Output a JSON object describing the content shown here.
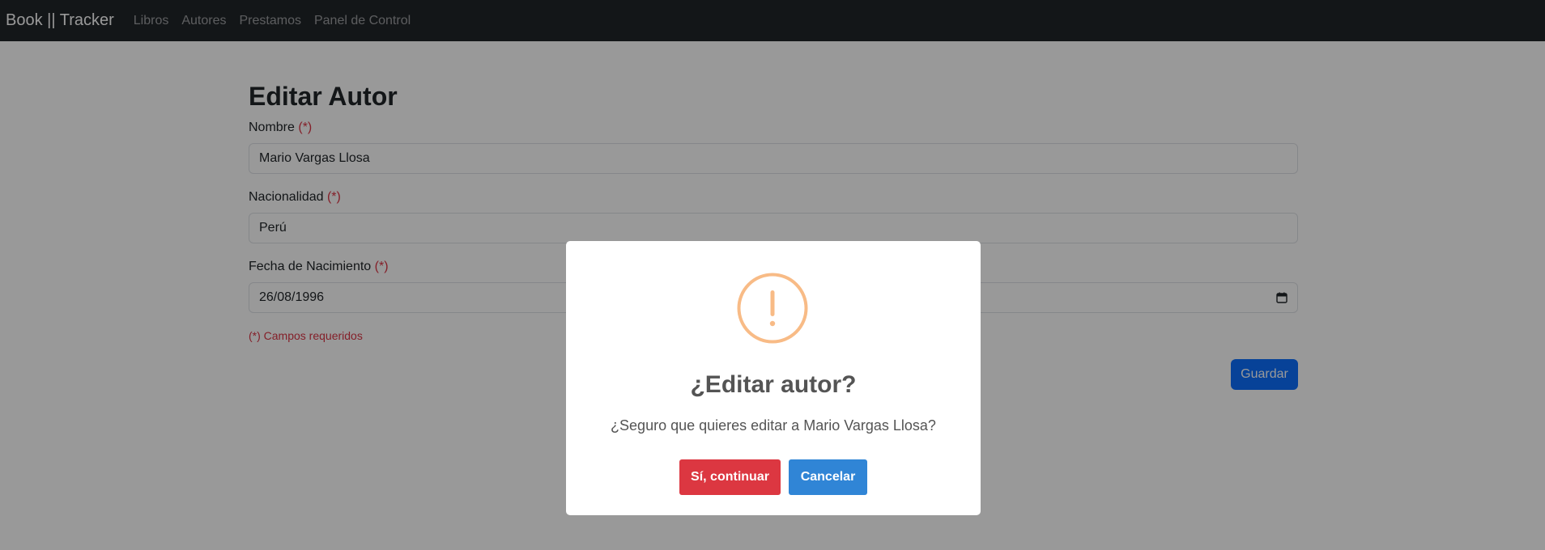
{
  "navbar": {
    "brand": "Book || Tracker",
    "links": [
      "Libros",
      "Autores",
      "Prestamos",
      "Panel de Control"
    ]
  },
  "form": {
    "title": "Editar Autor",
    "required_marker": "(*)",
    "fields": [
      {
        "label": "Nombre",
        "value": "Mario Vargas Llosa"
      },
      {
        "label": "Nacionalidad",
        "value": "Perú"
      },
      {
        "label": "Fecha de Nacimiento",
        "value": "26/08/1996"
      }
    ],
    "required_note": "(*) Campos requeridos",
    "save_label": "Guardar"
  },
  "modal": {
    "icon": "exclamation-icon",
    "icon_color": "#f8bb86",
    "title": "¿Editar autor?",
    "text": "¿Seguro que quieres editar a Mario Vargas Llosa?",
    "confirm_label": "Sí, continuar",
    "cancel_label": "Cancelar",
    "confirm_color": "#dc3741",
    "cancel_color": "#3085d6"
  }
}
